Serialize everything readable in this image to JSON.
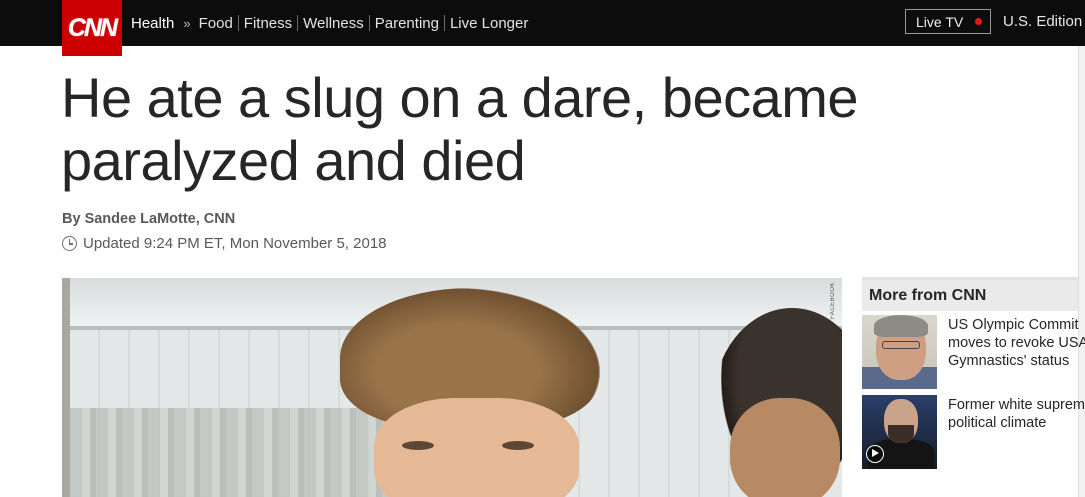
{
  "header": {
    "logo_text": "CNN",
    "section": "Health",
    "breadcrumb_sep": "»",
    "nav_items": [
      "Food",
      "Fitness",
      "Wellness",
      "Parenting",
      "Live Longer"
    ],
    "live_tv_label": "Live TV",
    "edition_label": "U.S. Edition",
    "colors": {
      "bar": "#0c0c0c",
      "logo": "#cc0000",
      "live_dot": "#e21b1b"
    }
  },
  "article": {
    "headline_line1": "He ate a slug on a dare, became",
    "headline_line2": "paralyzed and died",
    "byline": "By Sandee LaMotte, CNN",
    "updated": "Updated 9:24 PM ET, Mon November 5, 2018",
    "image_credit": "FACEBOOK"
  },
  "sidebar": {
    "title": "More from CNN",
    "stories": [
      {
        "text_line1": "US Olympic Commit",
        "text_line2": "moves to revoke USA",
        "text_line3": "Gymnastics' status",
        "thumb_icon": "photo-thumbnail"
      },
      {
        "text_line1": "Former white suprem",
        "text_line2": "political climate",
        "thumb_icon": "video-thumbnail"
      }
    ]
  }
}
